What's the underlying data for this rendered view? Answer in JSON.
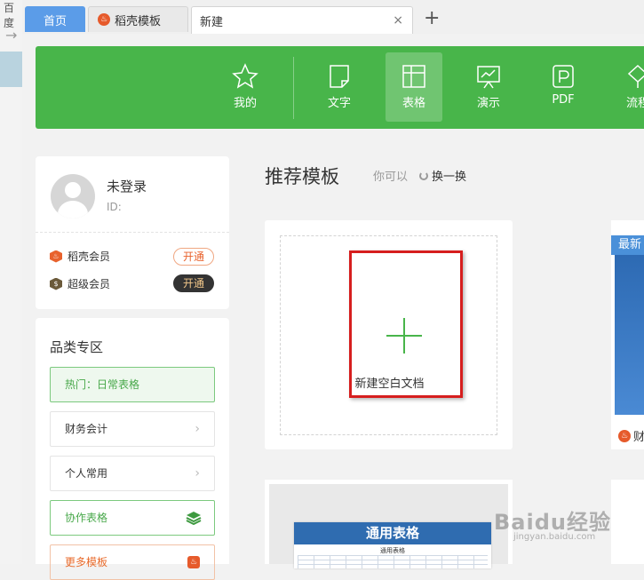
{
  "browser": {
    "left_title": "百度",
    "left_arrow": "→"
  },
  "tabs": {
    "home": "首页",
    "daoke": "稻壳模板",
    "new": "新建",
    "close": "×",
    "add": "+"
  },
  "categories": [
    {
      "label": "我的",
      "icon": "star-icon"
    },
    {
      "label": "文字",
      "icon": "document-icon"
    },
    {
      "label": "表格",
      "icon": "table-icon",
      "active": true
    },
    {
      "label": "演示",
      "icon": "presentation-icon"
    },
    {
      "label": "PDF",
      "icon": "pdf-icon"
    },
    {
      "label": "流程",
      "icon": "flow-icon"
    }
  ],
  "user": {
    "name": "未登录",
    "id_label": "ID:",
    "memberships": [
      {
        "label": "稻壳会员",
        "button": "开通",
        "icon": "daoke-member-icon"
      },
      {
        "label": "超级会员",
        "button": "开通",
        "icon": "super-member-icon"
      }
    ]
  },
  "category_zone": {
    "title": "品类专区",
    "items": [
      {
        "label": "热门：日常表格",
        "style": "hot"
      },
      {
        "label": "财务会计",
        "style": "normal"
      },
      {
        "label": "个人常用",
        "style": "normal"
      },
      {
        "label": "协作表格",
        "style": "green"
      },
      {
        "label": "更多模板",
        "style": "orange"
      }
    ]
  },
  "recommend": {
    "title": "推荐模板",
    "hint": "你可以",
    "refresh": "换一换",
    "blank_label": "新建空白文档",
    "right_badge": "最新",
    "right_footer": "财",
    "template_title": "通用表格",
    "template_sub": "通用表格"
  },
  "watermark": {
    "main": "Baidu经验",
    "sub": "jingyan.baidu.com"
  },
  "colors": {
    "green": "#48b54a",
    "tab_blue": "#5b9ce8",
    "highlight_red": "#d61e1e"
  }
}
